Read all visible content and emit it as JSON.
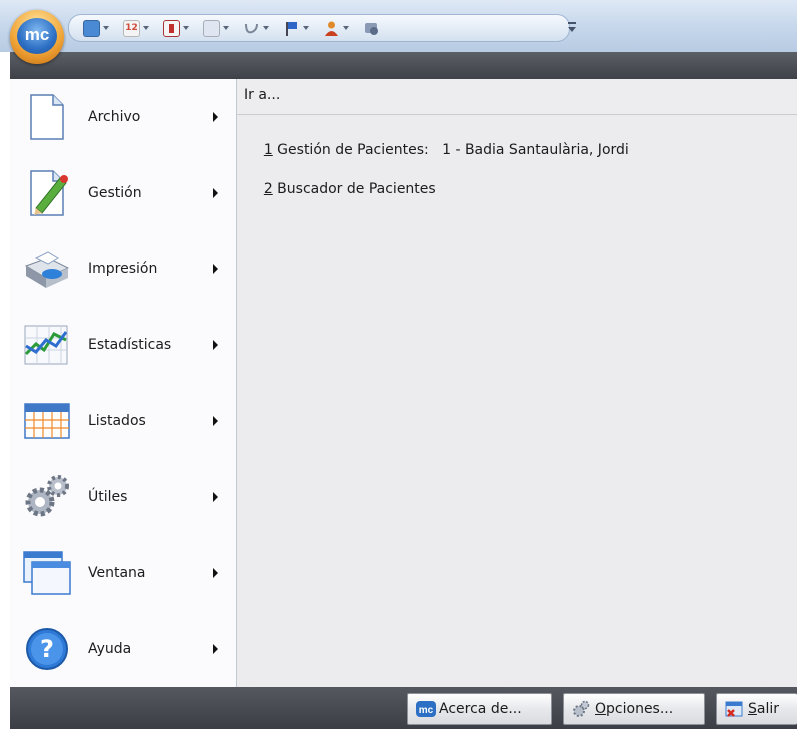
{
  "app": {
    "logo_text": "mc"
  },
  "quick_access": {
    "buttons": [
      {
        "icon": "contact-card-icon",
        "color": "#4a8ad4"
      },
      {
        "icon": "calendar-12-icon",
        "color": "#d04a3c",
        "text": "12"
      },
      {
        "icon": "bookmark-document-icon",
        "color": "#c0302c"
      },
      {
        "icon": "clipboard-user-icon",
        "color": "#6d86b0"
      },
      {
        "icon": "stethoscope-icon",
        "color": "#8b97a8"
      },
      {
        "icon": "flag-icon",
        "color": "#2f67c9"
      },
      {
        "icon": "user-icon",
        "color": "#e08a2c"
      },
      {
        "icon": "print-preview-icon",
        "color": "#6b7d99"
      }
    ]
  },
  "menu": {
    "items": [
      {
        "label": "Archivo",
        "icon": "document-icon"
      },
      {
        "label": "Gestión",
        "icon": "edit-document-icon"
      },
      {
        "label": "Impresión",
        "icon": "printer-icon"
      },
      {
        "label": "Estadísticas",
        "icon": "chart-icon"
      },
      {
        "label": "Listados",
        "icon": "calendar-grid-icon"
      },
      {
        "label": "Útiles",
        "icon": "gears-icon"
      },
      {
        "label": "Ventana",
        "icon": "windows-icon"
      },
      {
        "label": "Ayuda",
        "icon": "help-icon"
      }
    ]
  },
  "goto": {
    "title": "Ir a...",
    "recent": [
      {
        "number": "1",
        "text": " Gestión de Pacientes:   1 - Badia Santaulària, Jordi"
      },
      {
        "number": "2",
        "text": " Buscador de Pacientes"
      }
    ]
  },
  "footer": {
    "about": {
      "mnemonic": "",
      "label": "Acerca de..."
    },
    "options": {
      "mnemonic": "O",
      "label": "pciones..."
    },
    "exit": {
      "mnemonic": "S",
      "label": "alir"
    }
  },
  "colors": {
    "accent_blue": "#2d6fc4",
    "orb_orange": "#f2a73a",
    "dark_bar": "#45494f"
  }
}
